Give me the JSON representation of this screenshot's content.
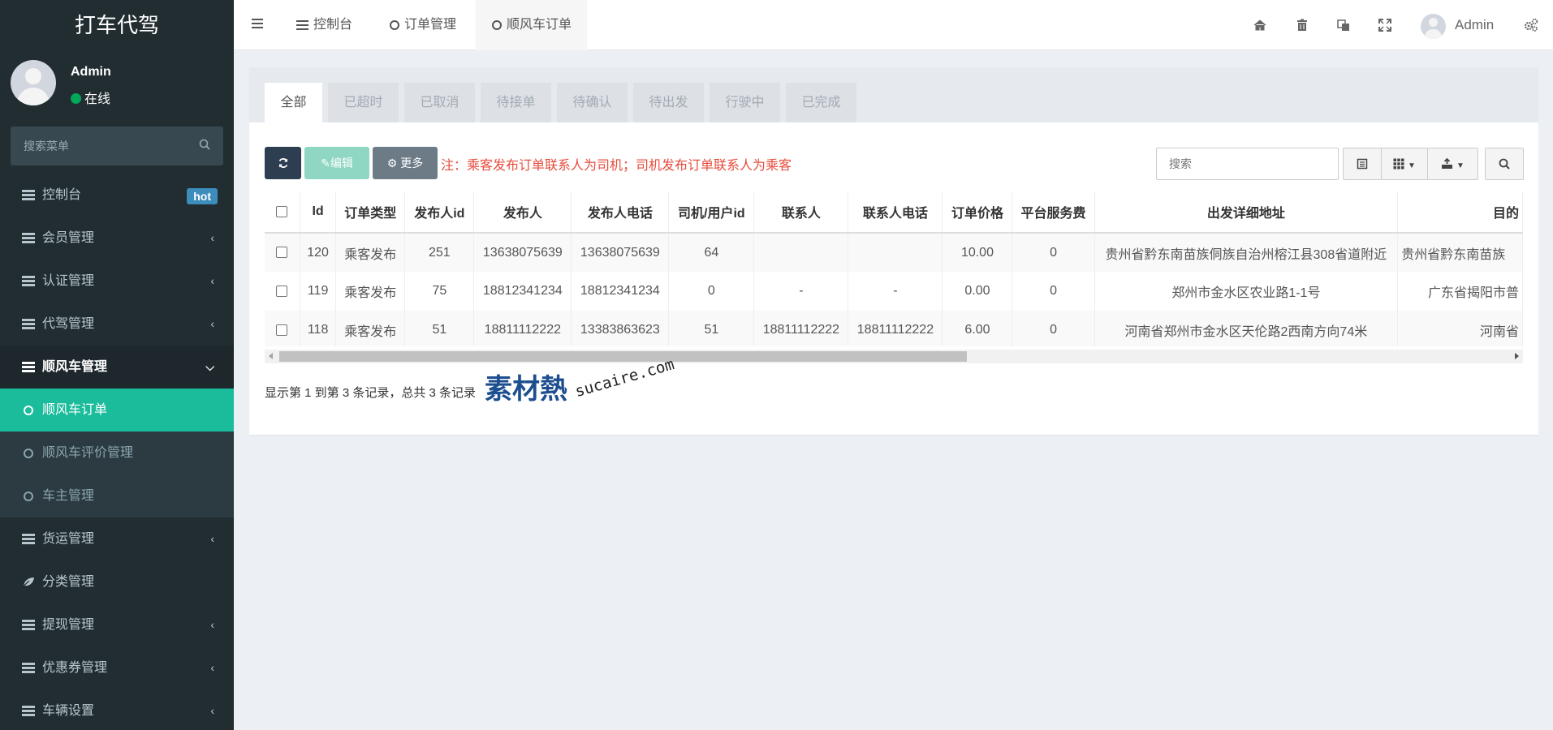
{
  "app": {
    "logo": "打车代驾"
  },
  "user": {
    "name": "Admin",
    "status": "在线"
  },
  "sidebar": {
    "search_placeholder": "搜索菜单",
    "items": [
      {
        "label": "控制台",
        "badge": "hot"
      },
      {
        "label": "会员管理"
      },
      {
        "label": "认证管理"
      },
      {
        "label": "代驾管理"
      },
      {
        "label": "顺风车管理"
      },
      {
        "label": "货运管理"
      },
      {
        "label": "分类管理"
      },
      {
        "label": "提现管理"
      },
      {
        "label": "优惠券管理"
      },
      {
        "label": "车辆设置"
      }
    ],
    "sub_items": [
      {
        "label": "顺风车订单"
      },
      {
        "label": "顺风车评价管理"
      },
      {
        "label": "车主管理"
      }
    ]
  },
  "header": {
    "tabs": [
      {
        "label": "控制台"
      },
      {
        "label": "订单管理"
      },
      {
        "label": "顺风车订单"
      }
    ],
    "admin_name": "Admin"
  },
  "status_tabs": [
    "全部",
    "已超时",
    "已取消",
    "待接单",
    "待确认",
    "待出发",
    "行驶中",
    "已完成"
  ],
  "toolbar": {
    "edit_label": "编辑",
    "more_label": "更多",
    "note": "注：乘客发布订单联系人为司机；司机发布订单联系人为乘客",
    "search_placeholder": "搜索"
  },
  "table": {
    "columns": [
      "Id",
      "订单类型",
      "发布人id",
      "发布人",
      "发布人电话",
      "司机/用户id",
      "联系人",
      "联系人电话",
      "订单价格",
      "平台服务费",
      "出发详细地址",
      "目的"
    ],
    "rows": [
      [
        "120",
        "乘客发布",
        "251",
        "13638075639",
        "13638075639",
        "64",
        "",
        "",
        "10.00",
        "0",
        "贵州省黔东南苗族侗族自治州榕江县308省道附近",
        "贵州省黔东南苗族"
      ],
      [
        "119",
        "乘客发布",
        "75",
        "18812341234",
        "18812341234",
        "0",
        "-",
        "-",
        "0.00",
        "0",
        "郑州市金水区农业路1-1号",
        "广东省揭阳市普"
      ],
      [
        "118",
        "乘客发布",
        "51",
        "18811112222",
        "13383863623",
        "51",
        "18811112222",
        "18811112222",
        "6.00",
        "0",
        "河南省郑州市金水区天伦路2西南方向74米",
        "河南省"
      ]
    ]
  },
  "summary": "显示第 1 到第 3 条记录，总共 3 条记录",
  "watermark": {
    "chars": "素材熱",
    "domain": "sucaire.com"
  },
  "colors": {
    "sidebar_bg": "#222d32",
    "active_sub": "#1abc9c",
    "badge": "#3c8dbc",
    "note": "#e74c3c"
  }
}
